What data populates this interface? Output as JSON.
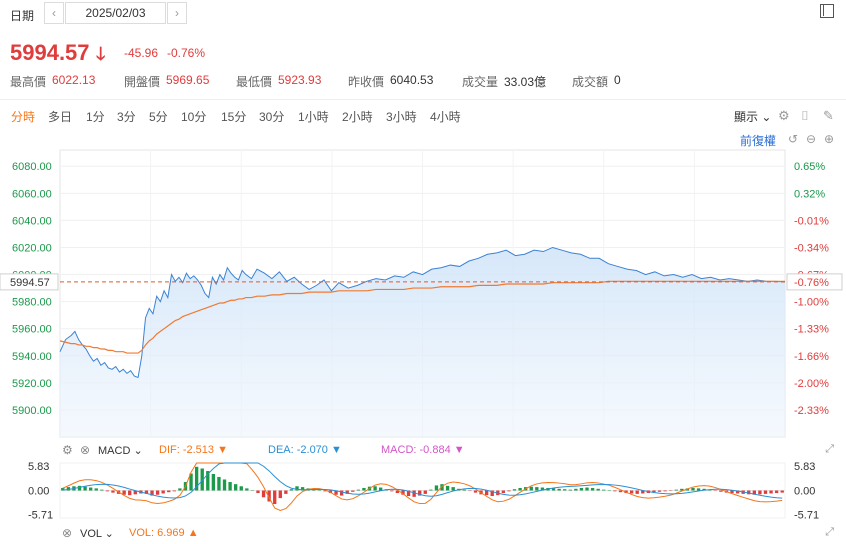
{
  "header": {
    "date_label": "日期",
    "prev_label": "‹",
    "next_label": "›",
    "date_value": "2025/02/03",
    "panel_icon": "panel-toggle-icon"
  },
  "quote": {
    "price": "5994.57",
    "arrow": "🡓",
    "change": "-45.96",
    "change_pct": "-0.76%",
    "colors": {
      "down": "#e03c3c",
      "up": "#1a9a4a"
    }
  },
  "stats": {
    "high_label": "最高價",
    "high_value": "6022.13",
    "open_label": "開盤價",
    "open_value": "5969.65",
    "low_label": "最低價",
    "low_value": "5923.93",
    "prev_close_label": "昨收價",
    "prev_close_value": "6040.53",
    "volume_label": "成交量",
    "volume_value": "33.03億",
    "turnover_label": "成交額",
    "turnover_value": "0"
  },
  "tabs": {
    "items": [
      "分時",
      "多日",
      "1分",
      "3分",
      "5分",
      "10分",
      "15分",
      "30分",
      "1小時",
      "2小時",
      "3小時",
      "4小時"
    ],
    "active": "分時",
    "display_label": "顯示 ⌄",
    "icons": [
      "settings-icon",
      "camera-icon",
      "edit-icon"
    ]
  },
  "adjust": {
    "label": "前復權",
    "icons": [
      "undo-icon",
      "zoom-out-icon",
      "zoom-in-icon"
    ]
  },
  "macd_header": {
    "name": "MACD ⌄",
    "dif": "DIF: -2.513 ▼",
    "dea": "DEA: -2.070 ▼",
    "macd": "MACD: -0.884 ▼",
    "colors": {
      "dif": "#f5761a",
      "dea": "#2a8fd6",
      "macd": "#d157c6"
    }
  },
  "vol_header": {
    "name": "VOL ⌄",
    "vol": "VOL: 6.969 ▲",
    "color": "#f5761a"
  },
  "chart_data": [
    {
      "type": "line",
      "title": "",
      "y_labels": [
        "6080.00",
        "6060.00",
        "6040.00",
        "6020.00",
        "6000.00",
        "5980.00",
        "5960.00",
        "5940.00",
        "5920.00",
        "5900.00"
      ],
      "y_ticks": [
        6080,
        6060,
        6040,
        6020,
        6000,
        5980,
        5960,
        5940,
        5920,
        5900
      ],
      "pct_labels": [
        "0.65%",
        "0.32%",
        "-0.01%",
        "-0.34%",
        "-0.67%",
        "-1.00%",
        "-1.33%",
        "-1.66%",
        "-2.00%",
        "-2.33%"
      ],
      "current_price_label": "5994.57",
      "current_pct_label": "-0.76%",
      "current_price": 5994.57,
      "ylim": [
        5880,
        6092
      ],
      "x": [
        0,
        3,
        6,
        8,
        10,
        12,
        14,
        16,
        18,
        20,
        22,
        24,
        26,
        28,
        30,
        32,
        34,
        36,
        38,
        40,
        42,
        44,
        46,
        48,
        50,
        52,
        54,
        56,
        58,
        60,
        62,
        64,
        66,
        68,
        70,
        72,
        74,
        76,
        78,
        80,
        82,
        84,
        86,
        88,
        90,
        92,
        94,
        96,
        98,
        100,
        103,
        106,
        110,
        114,
        118,
        122,
        126,
        130,
        134,
        138,
        142,
        146,
        150,
        155,
        160,
        165,
        170,
        175,
        180,
        185,
        190,
        195,
        200,
        205,
        210,
        215,
        220,
        225,
        230,
        235,
        240,
        245,
        250,
        255,
        260,
        265,
        270,
        275,
        280,
        285,
        290,
        295,
        300,
        305,
        310,
        315,
        320,
        325,
        330,
        335,
        340,
        345,
        350,
        355,
        360,
        365,
        370,
        375,
        380,
        385,
        390
      ],
      "series": [
        {
          "name": "price",
          "color": "#3b82d4",
          "values": [
            5943,
            5952,
            5955,
            5958,
            5952,
            5948,
            5945,
            5940,
            5936,
            5938,
            5933,
            5935,
            5931,
            5930,
            5932,
            5928,
            5930,
            5927,
            5929,
            5925,
            5924,
            5940,
            5968,
            5975,
            5971,
            5984,
            5980,
            5988,
            5983,
            6000,
            5995,
            5998,
            5994,
            6001,
            5997,
            5999,
            5996,
            5992,
            5986,
            5983,
            5998,
            5993,
            6000,
            5996,
            6005,
            6001,
            5998,
            5996,
            6003,
            6000,
            5997,
            6004,
            6001,
            5997,
            6002,
            5995,
            5998,
            5993,
            5989,
            5992,
            5996,
            5988,
            5994,
            5990,
            5992,
            5995,
            5997,
            5996,
            5999,
            5998,
            6002,
            6000,
            6004,
            6005,
            6007,
            6006,
            6010,
            6012,
            6015,
            6016,
            6018,
            6014,
            6015,
            6018,
            6017,
            6020,
            6018,
            6016,
            6015,
            6012,
            6012,
            6008,
            6006,
            6004,
            6003,
            6000,
            6002,
            5999,
            6000,
            5998,
            6000,
            5997,
            5998,
            5996,
            5997,
            5996,
            5995,
            5996,
            5995,
            5995,
            5994.57
          ]
        },
        {
          "name": "avg",
          "color": "#f07a32",
          "values": [
            5951,
            5950,
            5949,
            5949,
            5948,
            5948,
            5947,
            5947,
            5946,
            5946,
            5945,
            5945,
            5944,
            5944,
            5943,
            5943,
            5943,
            5942,
            5942,
            5942,
            5942,
            5944,
            5948,
            5951,
            5953,
            5956,
            5958,
            5960,
            5962,
            5964,
            5966,
            5967,
            5969,
            5970,
            5971,
            5972,
            5973,
            5974,
            5975,
            5976,
            5977,
            5978,
            5979,
            5979,
            5980,
            5981,
            5981,
            5982,
            5982,
            5983,
            5983,
            5984,
            5984,
            5985,
            5985,
            5986,
            5986,
            5986,
            5987,
            5987,
            5987,
            5987,
            5988,
            5988,
            5988,
            5988,
            5989,
            5989,
            5989,
            5989,
            5990,
            5990,
            5990,
            5991,
            5991,
            5991,
            5991,
            5992,
            5992,
            5992,
            5993,
            5993,
            5993,
            5993,
            5993,
            5994,
            5994,
            5994,
            5994,
            5994,
            5994,
            5995,
            5995,
            5995,
            5995,
            5995,
            5995,
            5995,
            5995,
            5995,
            5995,
            5995,
            5995,
            5995,
            5995,
            5995,
            5995,
            5995,
            5995,
            5995,
            5995
          ]
        }
      ]
    },
    {
      "type": "bar",
      "title": "MACD",
      "y_labels": [
        "5.83",
        "0.00",
        "-5.71"
      ],
      "y_ticks": [
        5.83,
        0,
        -5.71
      ],
      "ylim": [
        -6.5,
        6.5
      ],
      "x_count": 130,
      "series": [
        {
          "name": "MACD",
          "up_color": "#1a9a4a",
          "down_color": "#e03c3c",
          "values": [
            0.6,
            0.8,
            1.0,
            1.1,
            0.9,
            0.7,
            0.5,
            0.2,
            -0.2,
            -0.5,
            -0.8,
            -1.0,
            -1.1,
            -0.9,
            -0.7,
            -0.8,
            -1.2,
            -1.0,
            -0.7,
            -0.4,
            -0.2,
            0.5,
            2.0,
            4.0,
            5.6,
            5.2,
            4.6,
            3.9,
            3.2,
            2.6,
            2.0,
            1.5,
            1.0,
            0.5,
            0.1,
            -0.6,
            -1.6,
            -2.6,
            -3.2,
            -1.8,
            -0.8,
            0.3,
            1.0,
            0.8,
            0.5,
            0.3,
            0.1,
            -0.2,
            -0.6,
            -1.0,
            -1.2,
            -0.8,
            -0.3,
            0.2,
            0.6,
            0.9,
            1.0,
            0.7,
            0.3,
            -0.2,
            -0.6,
            -1.0,
            -1.3,
            -1.5,
            -1.2,
            -0.8,
            0.2,
            1.2,
            1.5,
            1.1,
            0.8,
            0.4,
            0.2,
            -0.1,
            -0.5,
            -0.9,
            -1.1,
            -1.3,
            -1.1,
            -0.6,
            -0.2,
            0.3,
            0.6,
            0.8,
            0.9,
            0.8,
            0.7,
            0.6,
            0.5,
            0.4,
            0.3,
            0.2,
            0.4,
            0.6,
            0.7,
            0.6,
            0.4,
            0.2,
            0.1,
            -0.2,
            -0.4,
            -0.6,
            -0.7,
            -0.8,
            -0.7,
            -0.6,
            -0.4,
            -0.3,
            -0.2,
            -0.1,
            0.2,
            0.4,
            0.5,
            0.6,
            0.5,
            0.4,
            0.2,
            -0.1,
            -0.3,
            -0.5,
            -0.6,
            -0.7,
            -0.8,
            -0.9,
            -1.0,
            -0.9,
            -0.8,
            -0.7,
            -0.6,
            -0.5
          ]
        }
      ]
    }
  ]
}
